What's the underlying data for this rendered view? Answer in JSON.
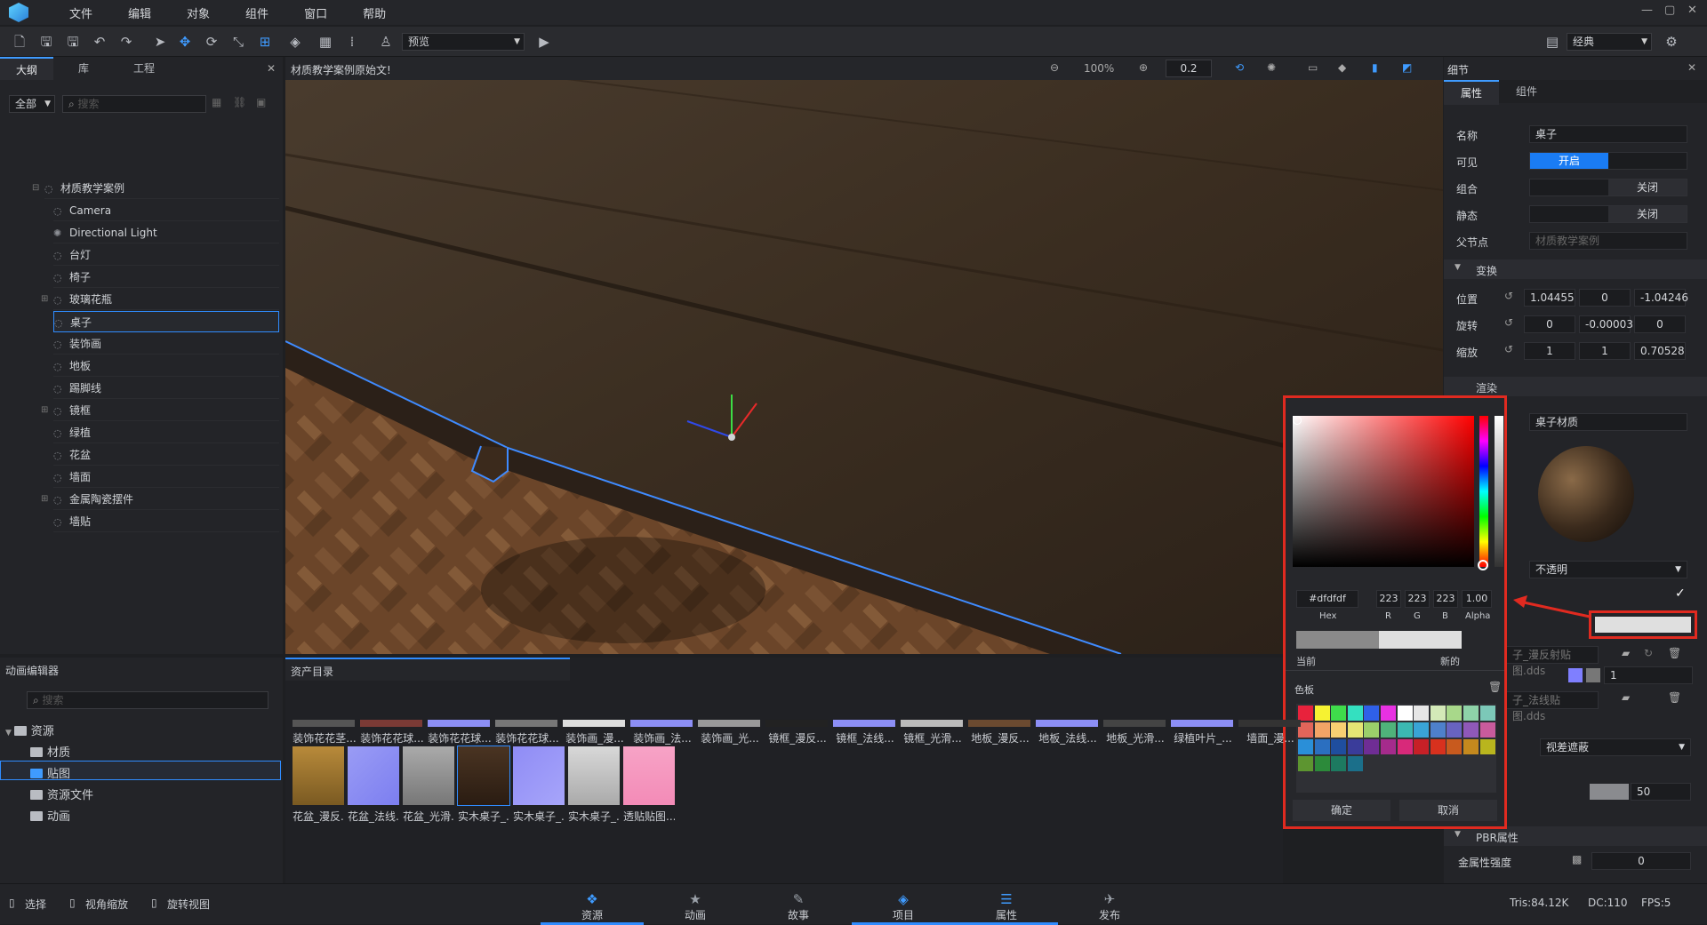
{
  "menu": [
    "文件",
    "编辑",
    "对象",
    "组件",
    "窗口",
    "帮助"
  ],
  "toolbar": {
    "preview_label": "预览",
    "layout_label": "经典"
  },
  "left_panel": {
    "tabs": [
      "大纲",
      "库",
      "工程"
    ],
    "filter": "全部",
    "search_placeholder": "搜索",
    "tree": [
      "材质教学案例",
      "Camera",
      "Directional Light",
      "台灯",
      "椅子",
      "玻璃花瓶",
      "桌子",
      "装饰画",
      "地板",
      "踢脚线",
      "镜框",
      "绿植",
      "花盆",
      "墙面",
      "金属陶瓷摆件",
      "墙贴"
    ]
  },
  "viewport": {
    "title": "材质教学案例原始文!",
    "zoom": "100%",
    "step": "0.2"
  },
  "details": {
    "title": "细节",
    "tabs": [
      "属性",
      "组件"
    ],
    "name_label": "名称",
    "name_value": "桌子",
    "visible_label": "可见",
    "visible_value": "开启",
    "group_label": "组合",
    "group_value": "关闭",
    "static_label": "静态",
    "static_value": "关闭",
    "parent_label": "父节点",
    "parent_value": "材质教学案例",
    "transform_label": "变换",
    "pos_label": "位置",
    "pos": [
      "1.04455",
      "0",
      "-1.04246"
    ],
    "rot_label": "旋转",
    "rot": [
      "0",
      "-0.00003",
      "0"
    ],
    "scale_label": "缩放",
    "scale": [
      "1",
      "1",
      "0.70528"
    ],
    "render_label": "渲染",
    "material": "桌子材质",
    "opacity": "不透明",
    "tex1": "子_漫反射贴图.dds",
    "tex1_val": "1",
    "tex2": "子_法线贴图.dds",
    "parallax": "视差遮蔽",
    "slider_val": "50",
    "pbr_label": "PBR属性",
    "metal_label": "金属性强度",
    "metal_val": "0"
  },
  "picker": {
    "hex": "#dfdfdf",
    "r": "223",
    "g": "223",
    "b": "223",
    "alpha": "1.00",
    "hex_lbl": "Hex",
    "r_lbl": "R",
    "g_lbl": "G",
    "b_lbl": "B",
    "alpha_lbl": "Alpha",
    "current": "当前",
    "new": "新的",
    "palette": "色板",
    "ok": "确定",
    "cancel": "取消",
    "colors": [
      "#e8223c",
      "#f6f232",
      "#3fdc4b",
      "#34e0c0",
      "#2f60e8",
      "#e831e2",
      "#ffffff",
      "#e6e6e6",
      "#d3e9b8",
      "#a8d88a",
      "#8ed3a8",
      "#7cc8b8",
      "#e2655a",
      "#f3a466",
      "#f7d072",
      "#e4e574",
      "#9bcf6a",
      "#4fb37a",
      "#3bb8b2",
      "#39a4d6",
      "#4e80cc",
      "#6863c0",
      "#8f58b8",
      "#c95b9c",
      "#2a8fd8",
      "#2b6fc0",
      "#1f4e9e",
      "#3a3c9a",
      "#6f2d95",
      "#a52b8c",
      "#d8297a",
      "#c72027",
      "#d8311e",
      "#c85a1e",
      "#c5891e",
      "#b9b51e",
      "#5d9530",
      "#2c8a3a",
      "#1d7a60",
      "#1b6f8a"
    ]
  },
  "bottom_left": {
    "title": "动画编辑器",
    "search_placeholder": "搜索",
    "folders": [
      "资源",
      "材质",
      "贴图",
      "资源文件",
      "动画"
    ]
  },
  "assets": {
    "title": "资产目录",
    "row1": [
      "装饰花花茎...",
      "装饰花花球...",
      "装饰花花球...",
      "装饰花花球...",
      "装饰画_漫...",
      "装饰画_法...",
      "装饰画_光...",
      "镜框_漫反...",
      "镜框_法线...",
      "镜框_光滑...",
      "地板_漫反...",
      "地板_法线...",
      "地板_光滑...",
      "绿植叶片_...",
      "墙面_漫..."
    ],
    "row2": [
      "花盆_漫反...",
      "花盆_法线...",
      "花盆_光滑...",
      "实木桌子_...",
      "实木桌子_...",
      "实木桌子_...",
      "透贴贴图..."
    ]
  },
  "status": {
    "select": "选择",
    "zoom": "视角缩放",
    "rotate": "旋转视图",
    "tris": "Tris:84.12K",
    "dc": "DC:110",
    "fps": "FPS:5"
  },
  "bottom_tabs": [
    "资源",
    "动画",
    "故事",
    "项目",
    "属性",
    "发布"
  ]
}
